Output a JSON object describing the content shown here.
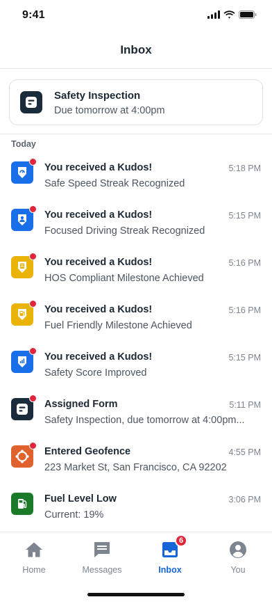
{
  "status_bar": {
    "time": "9:41"
  },
  "header": {
    "title": "Inbox"
  },
  "pinned": {
    "title": "Safety Inspection",
    "subtitle": "Due tomorrow at 4:00pm",
    "icon": "form-icon"
  },
  "section": {
    "label": "Today"
  },
  "items": [
    {
      "title": "You received a Kudos!",
      "subtitle": "Safe Speed Streak Recognized",
      "time": "5:18 PM",
      "icon": "speed-shield-icon",
      "color": "#1a6fe8",
      "unread": true
    },
    {
      "title": "You received a Kudos!",
      "subtitle": "Focused Driving Streak Recognized",
      "time": "5:15 PM",
      "icon": "driver-shield-icon",
      "color": "#1a6fe8",
      "unread": true
    },
    {
      "title": "You received a Kudos!",
      "subtitle": "HOS Compliant Milestone Achieved",
      "time": "5:16 PM",
      "icon": "hos-shield-icon",
      "color": "#e9b308",
      "unread": true
    },
    {
      "title": "You received a Kudos!",
      "subtitle": "Fuel Friendly Milestone Achieved",
      "time": "5:16 PM",
      "icon": "fuel-shield-icon",
      "color": "#e9b308",
      "unread": true
    },
    {
      "title": "You received a Kudos!",
      "subtitle": "Safety Score Improved",
      "time": "5:15 PM",
      "icon": "score-shield-icon",
      "color": "#1a6fe8",
      "unread": true
    },
    {
      "title": "Assigned Form",
      "subtitle": "Safety Inspection, due tomorrow at 4:00pm...",
      "time": "5:11 PM",
      "icon": "form-icon",
      "color": "#1a2b3c",
      "unread": true
    },
    {
      "title": "Entered Geofence",
      "subtitle": "223 Market St, San Francisco, CA 92202",
      "time": "4:55 PM",
      "icon": "geofence-icon",
      "color": "#e0632e",
      "unread": true
    },
    {
      "title": "Fuel Level Low",
      "subtitle": "Current: 19%",
      "time": "3:06 PM",
      "icon": "fuel-pump-icon",
      "color": "#1b7a2a",
      "unread": false
    }
  ],
  "tabs": [
    {
      "label": "Home",
      "icon": "home-icon",
      "active": false
    },
    {
      "label": "Messages",
      "icon": "messages-icon",
      "active": false
    },
    {
      "label": "Inbox",
      "icon": "inbox-icon",
      "active": true,
      "badge": "6"
    },
    {
      "label": "You",
      "icon": "user-icon",
      "active": false
    }
  ],
  "colors": {
    "accent": "#1565d8",
    "unread_dot": "#e0263a"
  }
}
